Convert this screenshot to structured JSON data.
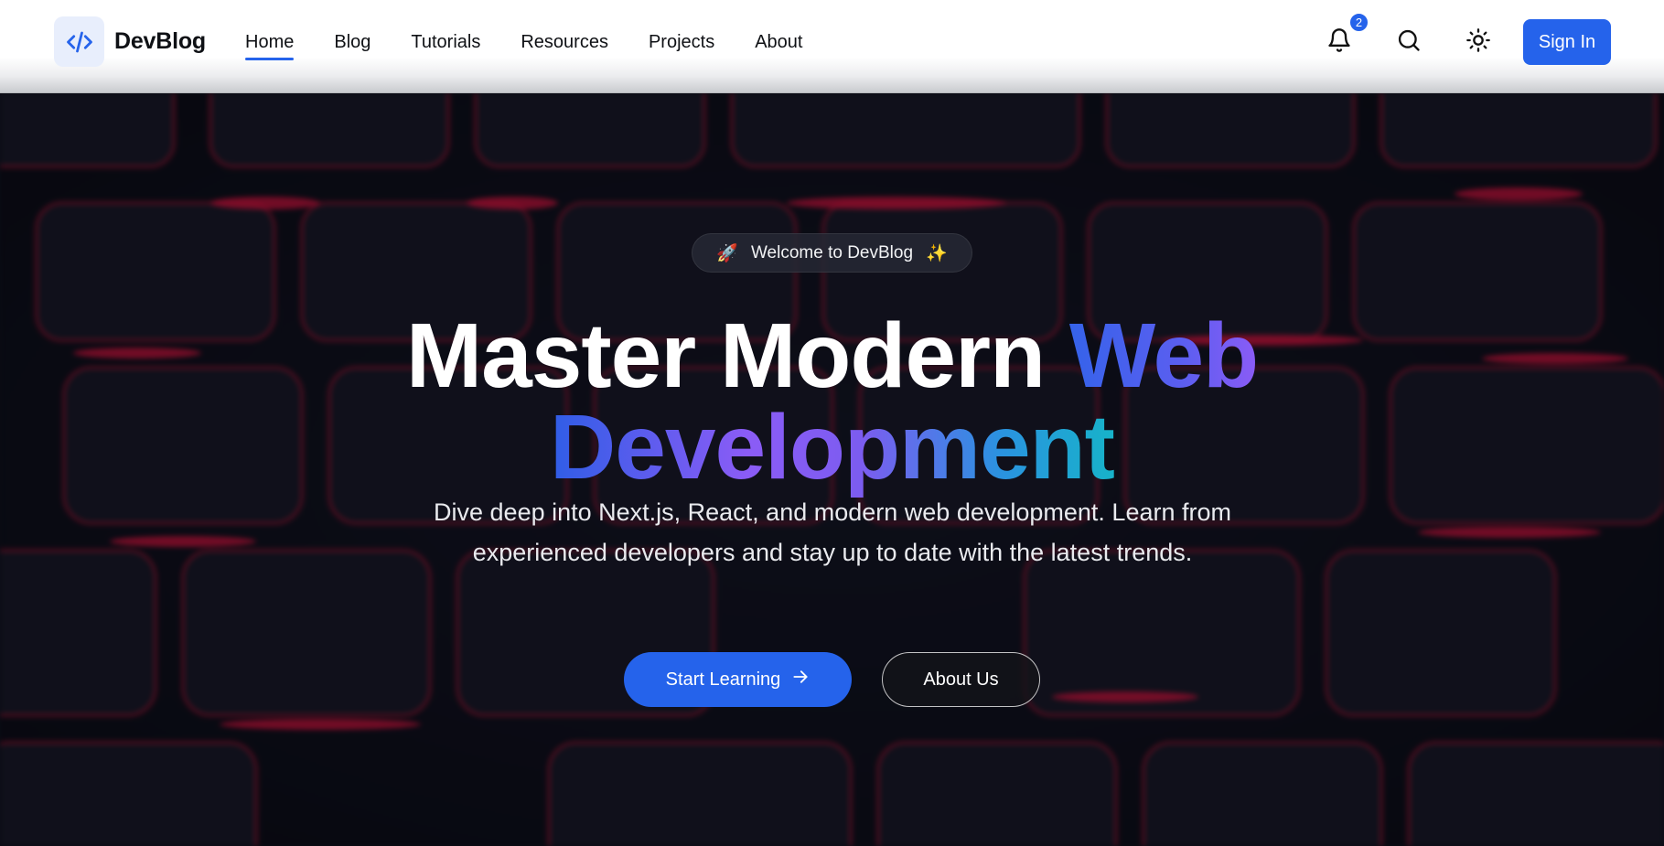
{
  "header": {
    "logo_text": "DevBlog",
    "nav": [
      {
        "label": "Home",
        "active": true
      },
      {
        "label": "Blog"
      },
      {
        "label": "Tutorials"
      },
      {
        "label": "Resources"
      },
      {
        "label": "Projects"
      },
      {
        "label": "About"
      }
    ],
    "notification_count": "2",
    "sign_in_label": "Sign In",
    "icons": [
      "code-icon",
      "bell-icon",
      "search-icon",
      "sun-icon"
    ]
  },
  "hero": {
    "pill_emoji_left": "🚀",
    "pill_text": "Welcome to DevBlog",
    "pill_emoji_right": "✨",
    "title_part1": "Master Modern ",
    "title_part2": "Web",
    "title_line2": "Development",
    "subtitle": "Dive deep into Next.js, React, and modern web development. Learn from experienced developers and stay up to date with the latest trends.",
    "primary_cta": "Start Learning",
    "secondary_cta": "About Us"
  },
  "colors": {
    "accent": "#2563eb",
    "gradient_start": "#2f5de6",
    "gradient_mid": "#8b5cf6",
    "gradient_end": "#17b3c9",
    "key_glow": "#e0103a"
  }
}
